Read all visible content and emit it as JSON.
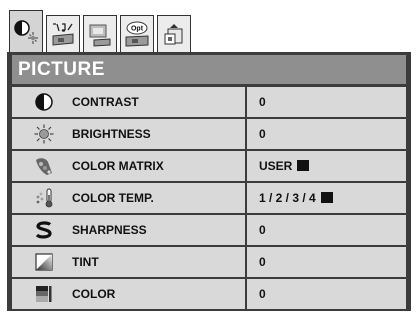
{
  "tabs": [
    {
      "icon": "picture-tab-icon",
      "active": true
    },
    {
      "icon": "sound-tab-icon",
      "active": false
    },
    {
      "icon": "image-setup-tab-icon",
      "active": false
    },
    {
      "icon": "option-tab-icon",
      "label": "Opt",
      "active": false
    },
    {
      "icon": "signal-tab-icon",
      "active": false
    }
  ],
  "title": "PICTURE",
  "rows": [
    {
      "label": "CONTRAST",
      "value": "0",
      "icon": "contrast-icon"
    },
    {
      "label": "BRIGHTNESS",
      "value": "0",
      "icon": "brightness-icon"
    },
    {
      "label": "COLOR MATRIX",
      "value": "USER",
      "icon": "color-matrix-icon",
      "marker": true
    },
    {
      "label": "COLOR TEMP.",
      "value": "1 / 2 / 3 / 4",
      "icon": "thermometer-icon",
      "marker": true
    },
    {
      "label": "SHARPNESS",
      "value": "0",
      "icon": "sharpness-icon"
    },
    {
      "label": "TINT",
      "value": "0",
      "icon": "tint-icon"
    },
    {
      "label": "COLOR",
      "value": "0",
      "icon": "color-icon"
    }
  ]
}
